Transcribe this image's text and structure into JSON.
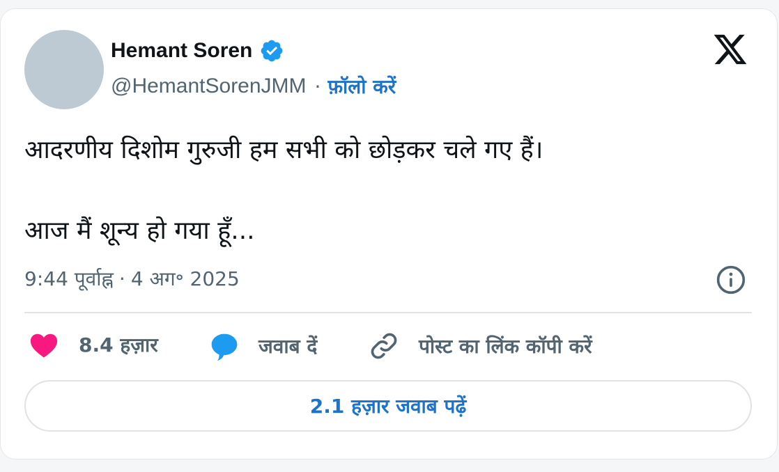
{
  "author": {
    "name": "Hemant Soren",
    "handle": "@HemantSorenJMM",
    "separator": "·",
    "follow_label": "फ़ॉलो करें"
  },
  "tweet": {
    "line1": "आदरणीय दिशोम गुरुजी हम सभी को छोड़कर चले गए हैं।",
    "line2": "आज मैं शून्य हो गया हूँ...",
    "time": "9:44 पूर्वाह्न",
    "separator": "·",
    "date": "4 अग॰ 2025"
  },
  "actions": {
    "likes_count": "8.4 हज़ार",
    "reply_label": "जवाब दें",
    "copy_link_label": "पोस्ट का लिंक कॉपी करें"
  },
  "read_replies_label": "2.1 हज़ार जवाब पढ़ें",
  "icons": {
    "verified": "verified-badge-icon",
    "logo": "x-logo-icon",
    "info": "info-icon",
    "like": "heart-icon",
    "reply": "speech-bubble-icon",
    "copy_link": "link-icon"
  },
  "colors": {
    "accent": "#1d72c9",
    "verified": "#1d9bf0",
    "heart": "#f91880",
    "text_primary": "#0f1419",
    "text_secondary": "#536471"
  }
}
